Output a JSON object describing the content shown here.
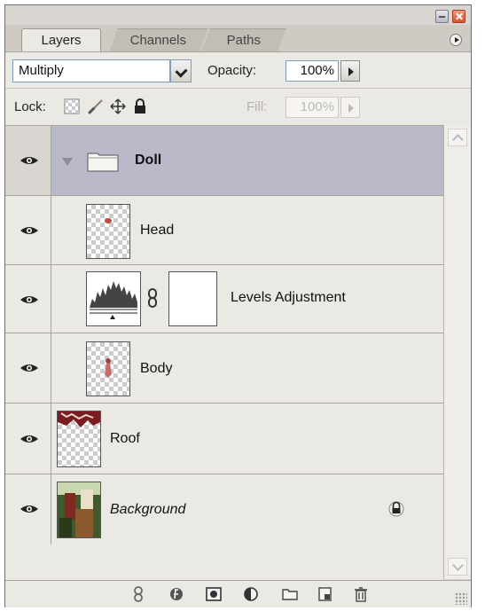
{
  "tabs": [
    "Layers",
    "Channels",
    "Paths"
  ],
  "options": {
    "blend_mode": "Multiply",
    "opacity_label": "Opacity:",
    "opacity_value": "100%",
    "lock_label": "Lock:",
    "fill_label": "Fill:",
    "fill_value": "100%"
  },
  "layers": {
    "doll": "Doll",
    "head": "Head",
    "levels": "Levels Adjustment",
    "body": "Body",
    "roof": "Roof",
    "background": "Background"
  },
  "icons": {
    "visibility": "eye-icon",
    "group": "folder-icon",
    "link": "chain-link-icon",
    "lock": "padlock-icon",
    "footer": [
      "link-layers-icon",
      "layer-style-icon",
      "layer-mask-icon",
      "adjustment-layer-icon",
      "new-group-icon",
      "new-layer-icon",
      "trash-icon"
    ]
  },
  "colors": {
    "selected_row": "#b9b9c9",
    "panel_bg": "#ebe9e4",
    "close_button": "#d8512f"
  }
}
